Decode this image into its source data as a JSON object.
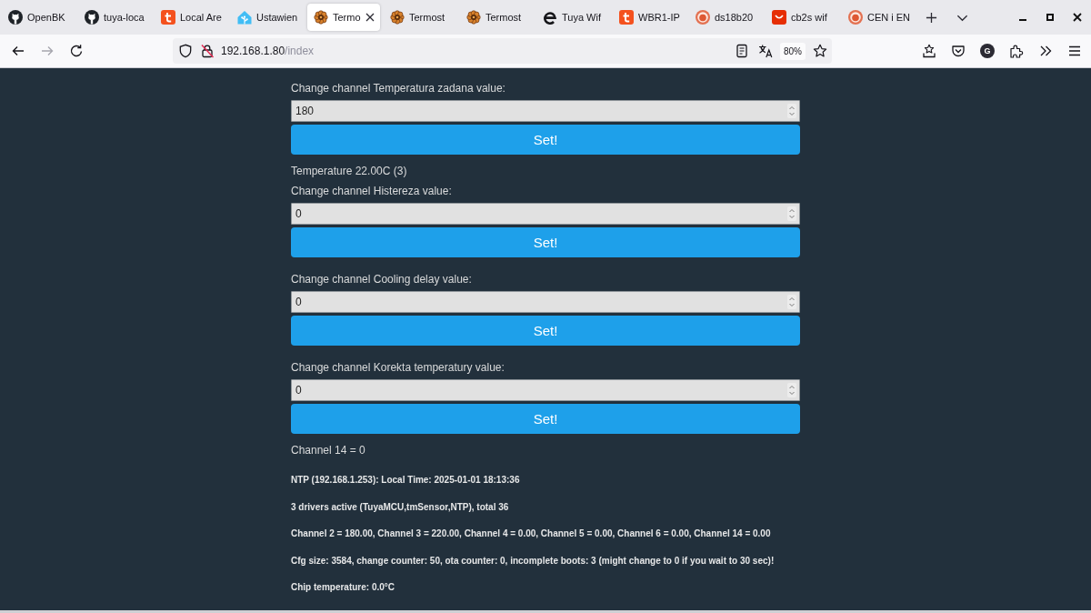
{
  "browser": {
    "tabs": [
      {
        "label": "OpenBK",
        "selected": false
      },
      {
        "label": "tuya-loca",
        "selected": false
      },
      {
        "label": "Local Are",
        "selected": false
      },
      {
        "label": "Ustawien",
        "selected": false
      },
      {
        "label": "Termo",
        "selected": true
      },
      {
        "label": "Termost",
        "selected": false
      },
      {
        "label": "Termost",
        "selected": false
      },
      {
        "label": "Tuya Wif",
        "selected": false
      },
      {
        "label": "WBR1-IP",
        "selected": false
      },
      {
        "label": "ds18b20",
        "selected": false
      },
      {
        "label": "cb2s wif",
        "selected": false
      },
      {
        "label": "CEN i EN",
        "selected": false
      }
    ],
    "navigation": {
      "back_disabled": false,
      "forward_disabled": true
    },
    "address_bar": {
      "host": "192.168.1.80",
      "path": "/index",
      "zoom": "80%",
      "bookmarked": false
    },
    "account_initial": "G"
  },
  "page": {
    "blocks": [
      {
        "kind": "control",
        "label": "Change channel Temperatura zadana value:",
        "value": "180",
        "button": "Set!"
      },
      {
        "kind": "text",
        "text": "Temperature 22.00C (3)"
      },
      {
        "kind": "control",
        "label": "Change channel Histereza value:",
        "value": "0",
        "button": "Set!"
      },
      {
        "kind": "control",
        "label": "Change channel Cooling delay value:",
        "value": "0",
        "button": "Set!"
      },
      {
        "kind": "control",
        "label": "Change channel Korekta temperatury value:",
        "value": "0",
        "button": "Set!"
      },
      {
        "kind": "text",
        "text": "Channel 14 = 0"
      }
    ],
    "status_lines": [
      "NTP (192.168.1.253): Local Time: 2025-01-01 18:13:36",
      "3 drivers active (TuyaMCU,tmSensor,NTP), total 36",
      "Channel 2 = 180.00, Channel 3 = 220.00, Channel 4 = 0.00, Channel 5 = 0.00, Channel 6 = 0.00, Channel 14 = 0.00",
      "Cfg size: 3584, change counter: 50, ota counter: 0, incomplete boots: 3 (might change to 0 if you wait to 30 sec)!",
      "Chip temperature: 0.0°C"
    ]
  }
}
